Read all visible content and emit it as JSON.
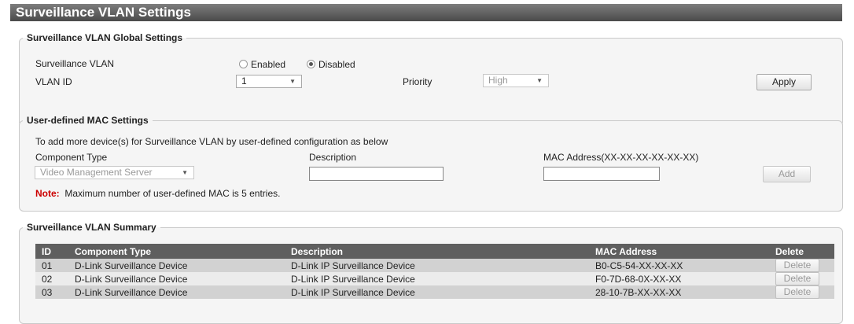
{
  "page": {
    "title": "Surveillance VLAN Settings"
  },
  "global": {
    "legend": "Surveillance VLAN Global Settings",
    "surveillance_label": "Surveillance VLAN",
    "enabled_label": "Enabled",
    "disabled_label": "Disabled",
    "selected_state": "Disabled",
    "vlan_id_label": "VLAN ID",
    "vlan_id_value": "1",
    "priority_label": "Priority",
    "priority_value": "High",
    "apply_label": "Apply"
  },
  "mac": {
    "legend": "User-defined MAC Settings",
    "intro": "To add more device(s) for Surveillance VLAN by user-defined configuration as below",
    "component_type_label": "Component Type",
    "component_type_value": "Video Management Server",
    "description_label": "Description",
    "description_value": "",
    "mac_label": "MAC Address(XX-XX-XX-XX-XX-XX)",
    "mac_value": "",
    "add_label": "Add",
    "note_label": "Note:",
    "note_text": "Maximum number of user-defined MAC is 5 entries."
  },
  "summary": {
    "legend": "Surveillance VLAN Summary",
    "columns": [
      "ID",
      "Component Type",
      "Description",
      "MAC Address",
      "Delete"
    ],
    "rows": [
      {
        "id": "01",
        "component": "D-Link Surveillance Device",
        "description": "D-Link IP Surveillance Device",
        "mac": "B0-C5-54-XX-XX-XX",
        "delete": "Delete"
      },
      {
        "id": "02",
        "component": "D-Link Surveillance Device",
        "description": "D-Link IP Surveillance Device",
        "mac": "F0-7D-68-0X-XX-XX",
        "delete": "Delete"
      },
      {
        "id": "03",
        "component": "D-Link Surveillance Device",
        "description": "D-Link IP Surveillance Device",
        "mac": "28-10-7B-XX-XX-XX",
        "delete": "Delete"
      }
    ]
  },
  "icons": {
    "dropdown": "chevron-down-icon",
    "radio": "radio-icon"
  },
  "colors": {
    "title_bar": "#5a5a5a",
    "table_header": "#5f5f5f",
    "note": "#cc0000",
    "row_odd": "#d2d2d2",
    "row_even": "#ececec"
  }
}
